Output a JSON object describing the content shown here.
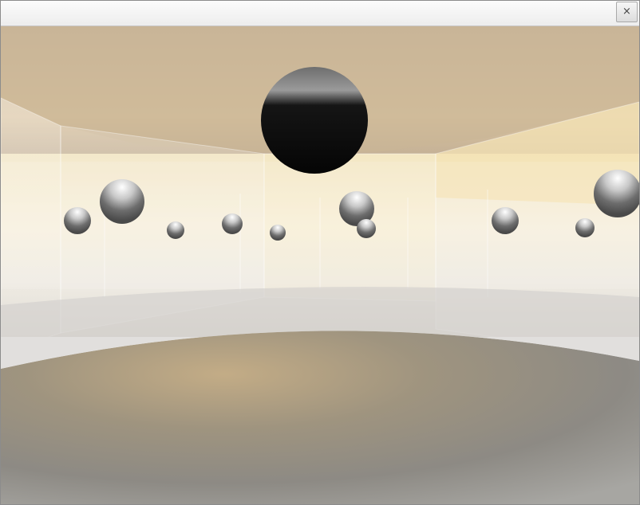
{
  "window": {
    "title": "",
    "close_label": "×"
  },
  "scene": {
    "icon": "3d-scene",
    "sky_color": "#d8c7a6",
    "floor_color": "#8d8578",
    "sphere_color": "#7f7f7f"
  }
}
